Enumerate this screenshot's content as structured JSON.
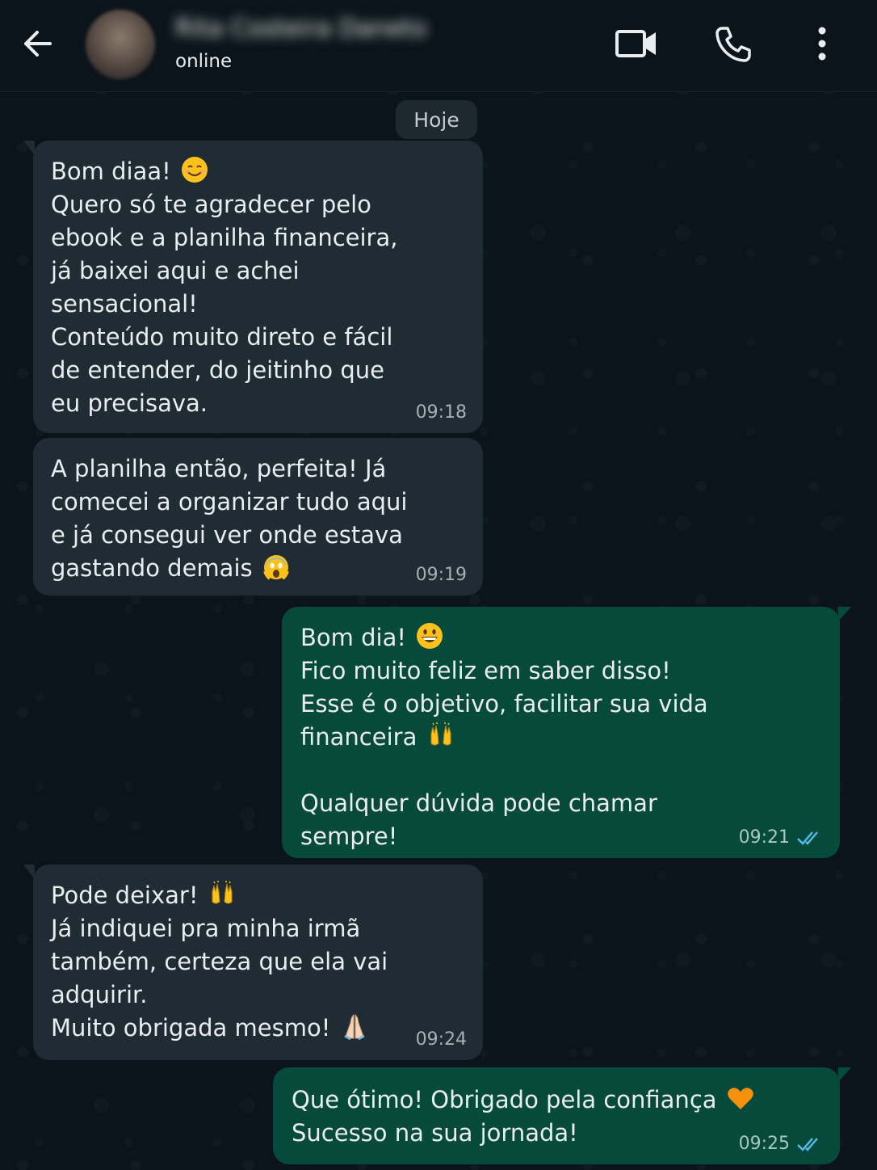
{
  "header": {
    "contact_name": "Rita Costeira Daneto",
    "status": "online",
    "icons": {
      "back": "arrow-back-icon",
      "video": "video-call-icon",
      "call": "phone-call-icon",
      "menu": "more-vertical-icon"
    }
  },
  "chat": {
    "date_chip": "Hoje",
    "messages": [
      {
        "direction": "incoming",
        "lines": [
          "Bom diaa!",
          "Quero só te agradecer pelo",
          "ebook e a planilha financeira,",
          "já baixei aqui e achei",
          "sensacional!",
          "Conteúdo muito direto e fácil",
          "de entender, do jeitinho que",
          "eu precisava."
        ],
        "emoji": "smiling-face",
        "time": "09:18"
      },
      {
        "direction": "incoming",
        "lines": [
          "A planilha então, perfeita! Já",
          "comecei a organizar tudo aqui",
          "e já consegui ver onde estava",
          "gastando demais"
        ],
        "emoji": "screaming-face",
        "time": "09:19"
      },
      {
        "direction": "outgoing",
        "lines": [
          "Bom dia!",
          "Fico muito feliz em saber disso!",
          "Esse é o objetivo, facilitar sua vida",
          "financeira",
          "",
          "Qualquer dúvida pode chamar",
          "sempre!"
        ],
        "emojis": [
          "grinning-face",
          "raising-hands"
        ],
        "time": "09:21",
        "status": "read"
      },
      {
        "direction": "incoming",
        "lines": [
          "Pode deixar!",
          "Já indiquei pra minha irmã",
          "também, certeza que ela vai",
          "adquirir.",
          "Muito obrigada mesmo!"
        ],
        "emojis": [
          "raising-hands",
          "folded-hands"
        ],
        "time": "09:24"
      },
      {
        "direction": "outgoing",
        "lines": [
          "Que ótimo! Obrigado pela confiança",
          "Sucesso na sua jornada!"
        ],
        "emoji": "orange-heart",
        "time": "09:25",
        "status": "read"
      }
    ]
  },
  "colors": {
    "background": "#0b141a",
    "incoming_bubble": "#1f2c34",
    "outgoing_bubble": "#064a3c",
    "read_ticks": "#53bdeb",
    "text": "#e9edef"
  }
}
